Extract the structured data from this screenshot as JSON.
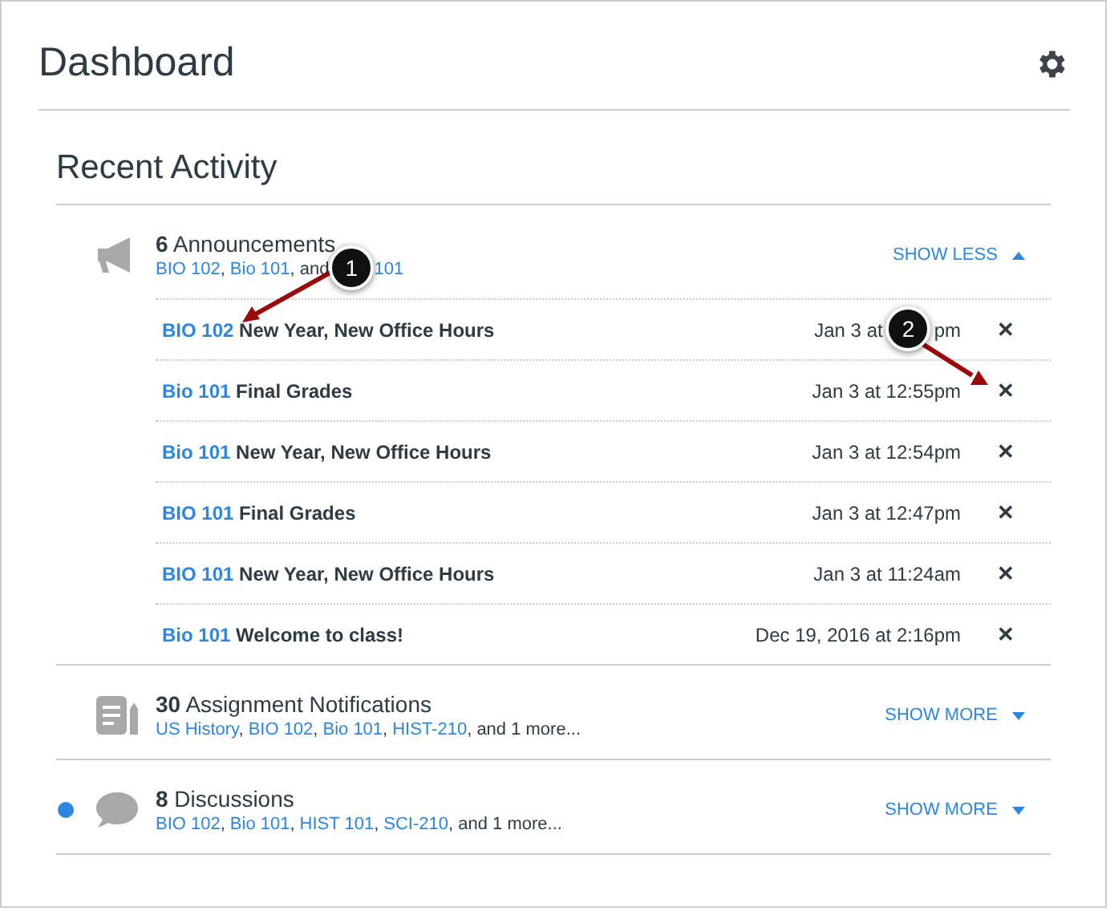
{
  "page_title": "Dashboard",
  "section_title": "Recent Activity",
  "groups": [
    {
      "kind": "announcement",
      "count": "6",
      "label": "Announcements",
      "courses": [
        "BIO 102",
        "Bio 101"
      ],
      "tail_before": ", and",
      "tail_course": "101",
      "callout": "1",
      "toggle": "SHOW LESS",
      "expanded": true,
      "unread": false,
      "items": [
        {
          "course": "BIO 102",
          "title": "New Year, New Office Hours",
          "date": "Jan 3 at",
          "callout": "2",
          "date_end": "pm"
        },
        {
          "course": "Bio 101",
          "title": "Final Grades",
          "date": "Jan 3 at 12:55pm"
        },
        {
          "course": "Bio 101",
          "title": "New Year, New Office Hours",
          "date": "Jan 3 at 12:54pm"
        },
        {
          "course": "BIO 101",
          "title": "Final Grades",
          "date": "Jan 3 at 12:47pm"
        },
        {
          "course": "BIO 101",
          "title": "New Year, New Office Hours",
          "date": "Jan 3 at 11:24am"
        },
        {
          "course": "Bio 101",
          "title": "Welcome to class!",
          "date": "Dec 19, 2016 at 2:16pm"
        }
      ]
    },
    {
      "kind": "assignment",
      "count": "30",
      "label": "Assignment Notifications",
      "courses": [
        "US History",
        "BIO 102",
        "Bio 101",
        "HIST-210"
      ],
      "tail": ", and 1 more...",
      "toggle": "SHOW MORE",
      "expanded": false,
      "unread": false
    },
    {
      "kind": "discussion",
      "count": "8",
      "label": "Discussions",
      "courses": [
        "BIO 102",
        "Bio 101",
        "HIST 101",
        "SCI-210"
      ],
      "tail": ", and 1 more...",
      "toggle": "SHOW MORE",
      "expanded": false,
      "unread": true
    }
  ],
  "separator": ",",
  "close_glyph": "✕"
}
